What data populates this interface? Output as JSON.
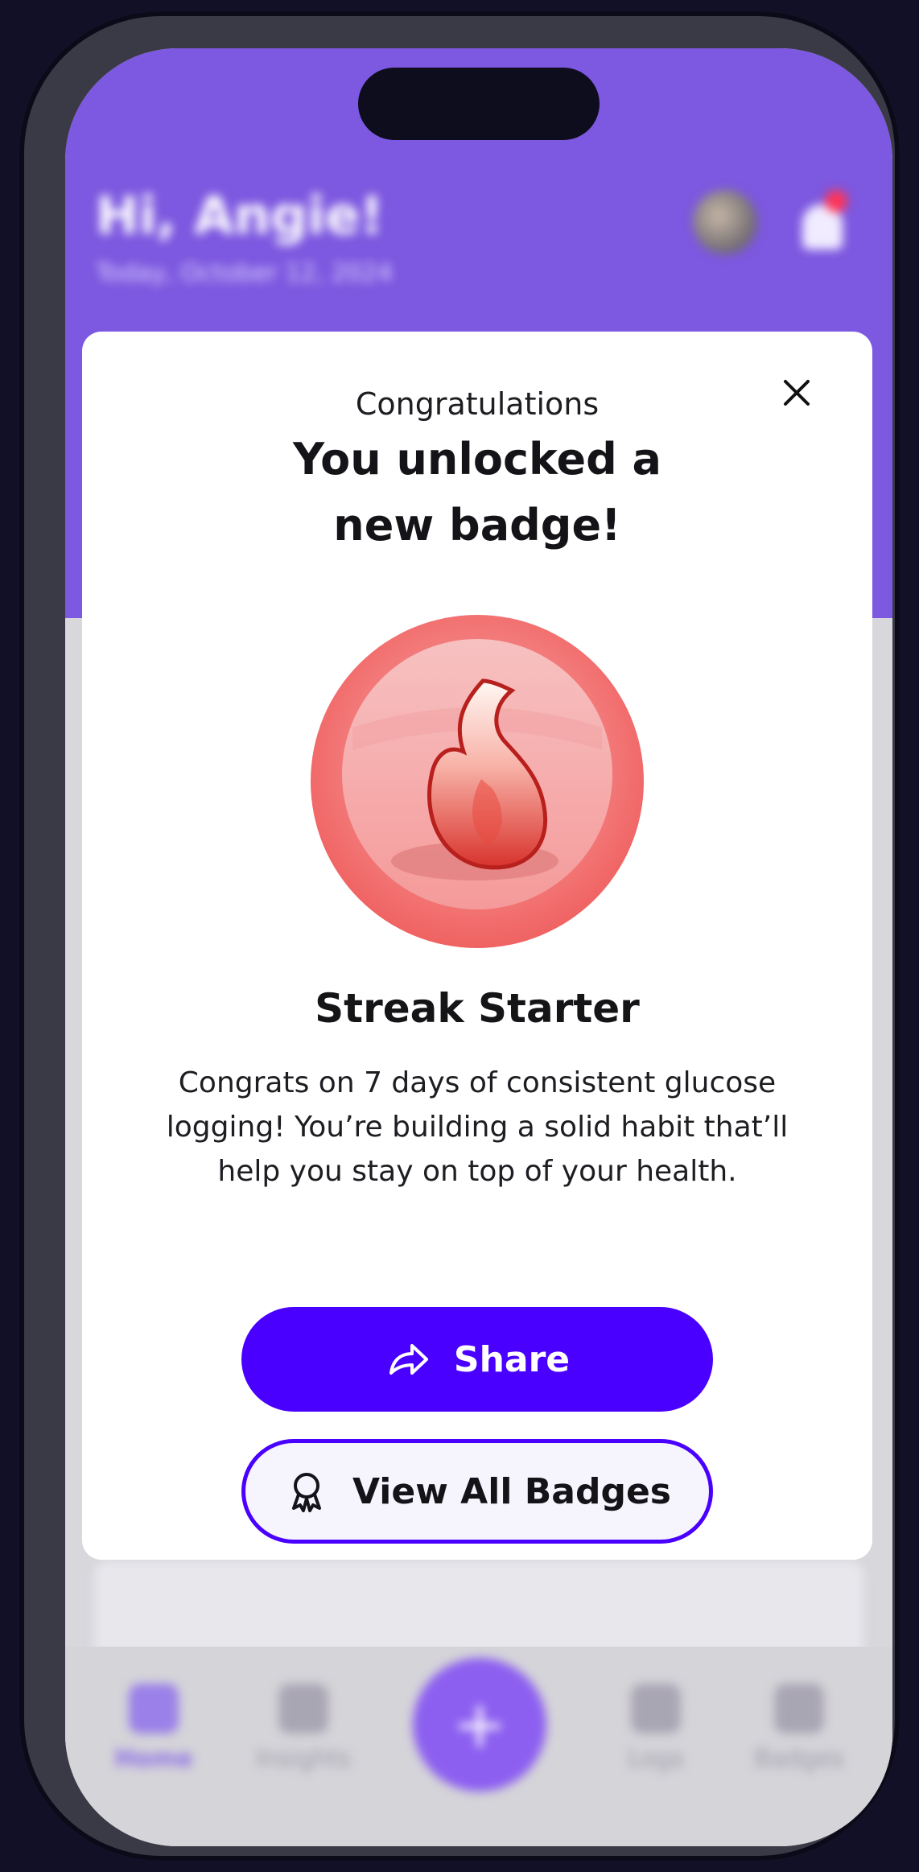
{
  "background_app": {
    "greeting": "Hi, Angie!",
    "date": "Today, October 12, 2024",
    "nav": {
      "home": "Home",
      "insights": "Insights",
      "fab_symbol": "+",
      "logs": "Logs",
      "badges": "Badges"
    }
  },
  "modal": {
    "eyebrow": "Congratulations",
    "headline_line1": "You unlocked a",
    "headline_line2": "new badge!",
    "badge_name": "Streak Starter",
    "badge_icon": "flame-icon",
    "description": "Congrats on 7 days of consistent glucose logging! You’re building a solid habit that’ll help you stay on top of your health.",
    "share_label": "Share",
    "view_all_label": "View All Badges"
  },
  "colors": {
    "header_purple": "#7d58e0",
    "primary": "#4a00ff",
    "badge_red": "#f06a6a"
  }
}
